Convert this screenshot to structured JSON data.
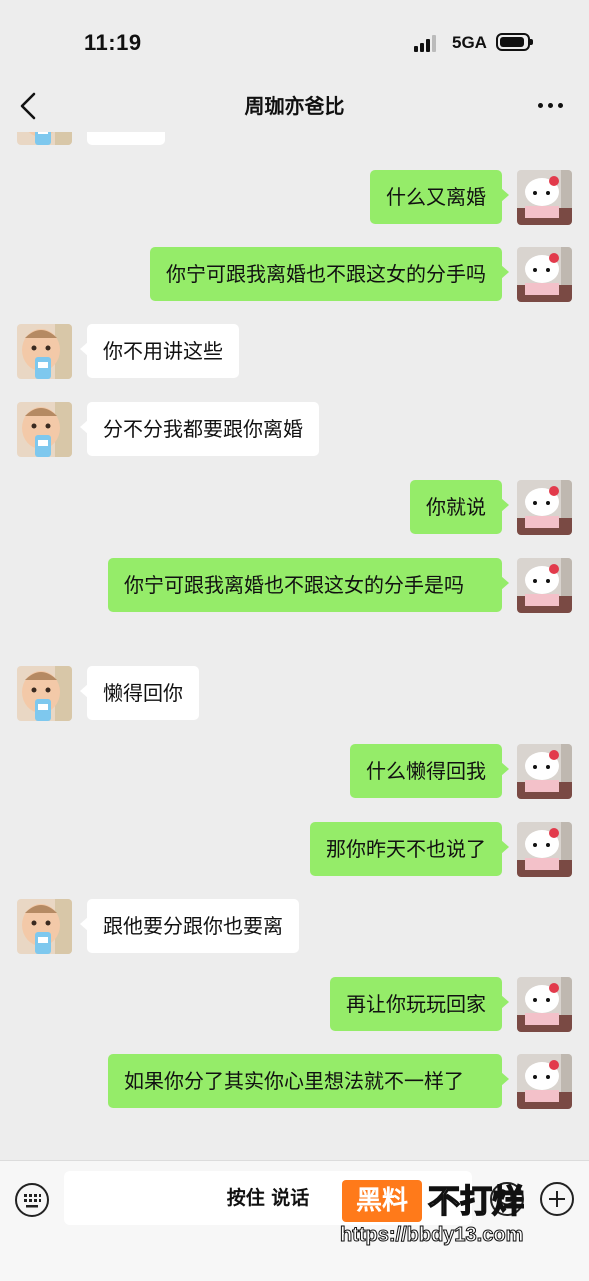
{
  "status_bar": {
    "time": "11:19",
    "network": "5GA"
  },
  "header": {
    "title": "周珈亦爸比"
  },
  "messages": [
    {
      "side": "in",
      "text": ""
    },
    {
      "side": "out",
      "text": "什么又离婚"
    },
    {
      "side": "out",
      "text": "你宁可跟我离婚也不跟这女的分手吗"
    },
    {
      "side": "in",
      "text": "你不用讲这些"
    },
    {
      "side": "in",
      "text": "分不分我都要跟你离婚"
    },
    {
      "side": "out",
      "text": "你就说"
    },
    {
      "side": "out",
      "text": "你宁可跟我离婚也不跟这女的分手是吗"
    },
    {
      "side": "in",
      "text": "懒得回你"
    },
    {
      "side": "out",
      "text": "什么懒得回我"
    },
    {
      "side": "out",
      "text": "那你昨天不也说了"
    },
    {
      "side": "in",
      "text": "跟他要分跟你也要离"
    },
    {
      "side": "out",
      "text": "再让你玩玩回家"
    },
    {
      "side": "out",
      "text": "如果你分了其实你心里想法就不一样了"
    }
  ],
  "input_bar": {
    "hold_to_talk": "按住 说话"
  },
  "watermark": {
    "badge": "黑料",
    "text": "不打烊",
    "url": "https://bbdy13.com"
  },
  "icons": {
    "back": "chevron-left-icon",
    "more": "more-dots-icon",
    "voice": "keyboard-icon",
    "emoji": "emoji-icon",
    "plus": "plus-icon",
    "avatar_in": "baby-avatar",
    "avatar_out": "hello-kitty-avatar"
  },
  "colors": {
    "background": "#ededed",
    "bubble_out": "#95ec69",
    "bubble_in": "#ffffff",
    "watermark_badge": "#ff7a1a"
  }
}
